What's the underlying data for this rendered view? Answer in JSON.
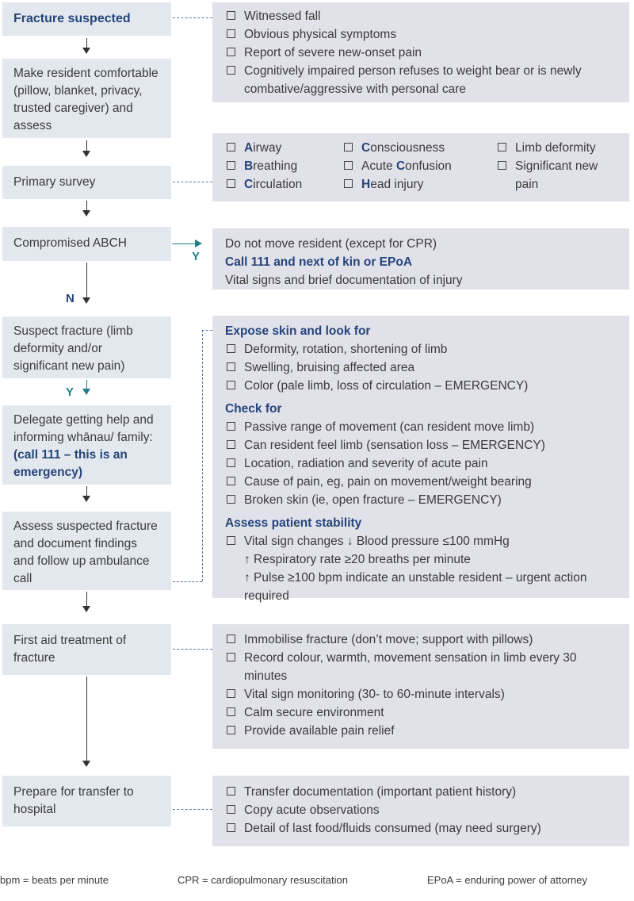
{
  "steps": {
    "fracture_suspected": "Fracture suspected",
    "make_comfortable": "Make resident comfortable (pillow, blanket, privacy, trusted caregiver) and assess",
    "primary_survey": "Primary survey",
    "compromised_abch": "Compromised ABCH",
    "suspect_fracture": "Suspect fracture (limb deformity and/or significant new pain)",
    "delegate_prefix": "Delegate getting help and informing whānau/ family: ",
    "delegate_emphasis": "(call 111 – this is an emergency)",
    "assess_suspected": "Assess suspected fracture and document findings and follow up ambulance call",
    "first_aid": "First aid treatment of fracture",
    "prepare_transfer": "Prepare for transfer to hospital"
  },
  "branch_labels": {
    "yes": "Y",
    "no": "N"
  },
  "fracture_signs": [
    "Witnessed fall",
    "Obvious physical symptoms",
    "Report of severe new-onset pain",
    "Cognitively impaired person refuses to weight bear or is newly combative/aggressive with personal care"
  ],
  "abch": {
    "col1": [
      {
        "initial": "A",
        "rest": "irway"
      },
      {
        "initial": "B",
        "rest": "reathing"
      },
      {
        "initial": "C",
        "rest": "irculation"
      }
    ],
    "col2": [
      {
        "pre": "",
        "initial": "C",
        "rest": "onsciousness"
      },
      {
        "pre": "Acute ",
        "initial": "C",
        "rest": "onfusion"
      },
      {
        "pre": "",
        "initial": "H",
        "rest": "ead injury"
      }
    ],
    "col3": [
      "Limb deformity",
      "Significant new pain"
    ]
  },
  "compromised_actions": {
    "line1": "Do not move resident (except for CPR)",
    "line2": "Call 111 and next of kin or EPoA",
    "line3": "Vital signs and brief documentation of injury"
  },
  "assessment": {
    "expose_heading": "Expose skin and look for",
    "expose_items": [
      "Deformity, rotation, shortening of limb",
      "Swelling, bruising affected area",
      "Color (pale limb, loss of circulation – EMERGENCY)"
    ],
    "check_heading": "Check for",
    "check_items": [
      "Passive range of movement (can resident move limb)",
      "Can resident feel limb (sensation loss – EMERGENCY)",
      "Location, radiation and severity of acute pain",
      "Cause of pain, eg, pain on movement/weight bearing",
      "Broken skin (ie, open fracture – EMERGENCY)"
    ],
    "stability_heading": "Assess patient stability",
    "stability_line1": "Vital sign changes ↓ Blood pressure ≤100 mmHg",
    "stability_line2": "↑ Respiratory rate ≥20 breaths per minute",
    "stability_line3": "↑ Pulse ≥100 bpm indicate an unstable resident – urgent action required"
  },
  "first_aid_items": [
    "Immobilise fracture (don’t move; support with pillows)",
    "Record colour, warmth, movement sensation in limb every 30 minutes",
    "Vital sign monitoring (30- to 60-minute intervals)",
    "Calm secure environment",
    "Provide available pain relief"
  ],
  "transfer_items": [
    "Transfer documentation (important patient history)",
    "Copy acute observations",
    "Detail of last food/fluids consumed (may need surgery)"
  ],
  "footnotes": {
    "bpm": "bpm = beats per minute",
    "cpr": "CPR = cardiopulmonary resuscitation",
    "epoa": "EPoA = enduring power of attorney"
  }
}
